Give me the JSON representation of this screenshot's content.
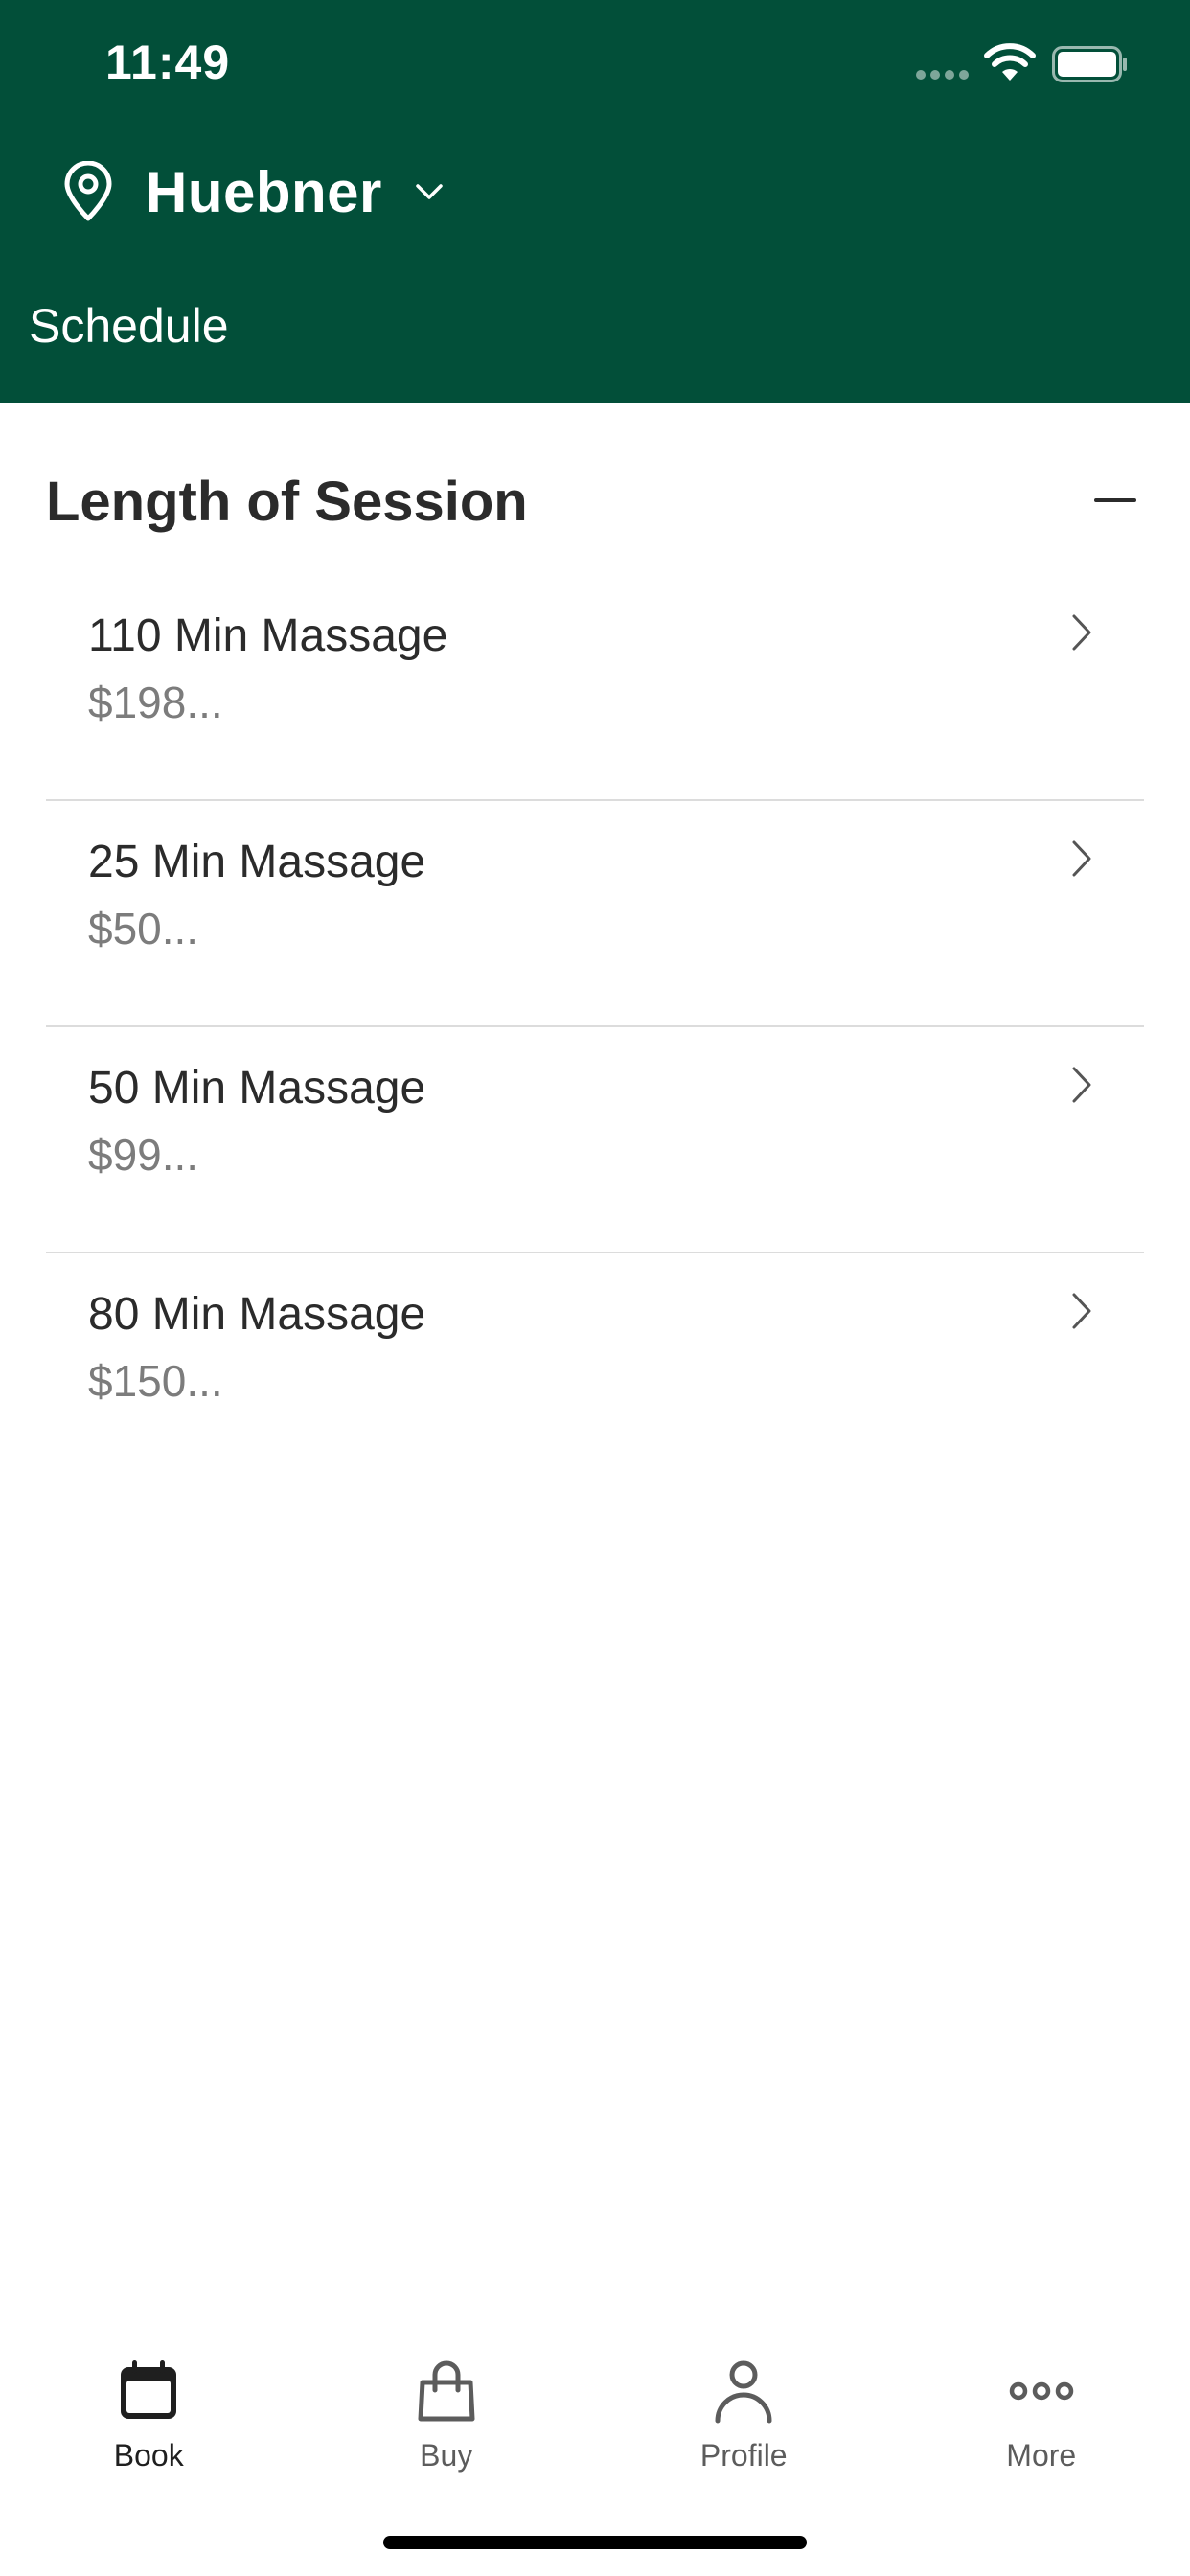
{
  "status_bar": {
    "time": "11:49"
  },
  "header": {
    "location": "Huebner",
    "subtitle": "Schedule",
    "background_color": "#024f39"
  },
  "section": {
    "title": "Length of Session"
  },
  "services": [
    {
      "name": "110 Min Massage",
      "price": "$198..."
    },
    {
      "name": "25 Min Massage",
      "price": "$50..."
    },
    {
      "name": "50 Min Massage",
      "price": "$99..."
    },
    {
      "name": "80 Min Massage",
      "price": "$150..."
    }
  ],
  "tab_bar": {
    "tabs": [
      {
        "label": "Book",
        "icon": "calendar-icon",
        "active": true
      },
      {
        "label": "Buy",
        "icon": "shopping-bag-icon",
        "active": false
      },
      {
        "label": "Profile",
        "icon": "person-icon",
        "active": false
      },
      {
        "label": "More",
        "icon": "more-dots-icon",
        "active": false
      }
    ]
  }
}
